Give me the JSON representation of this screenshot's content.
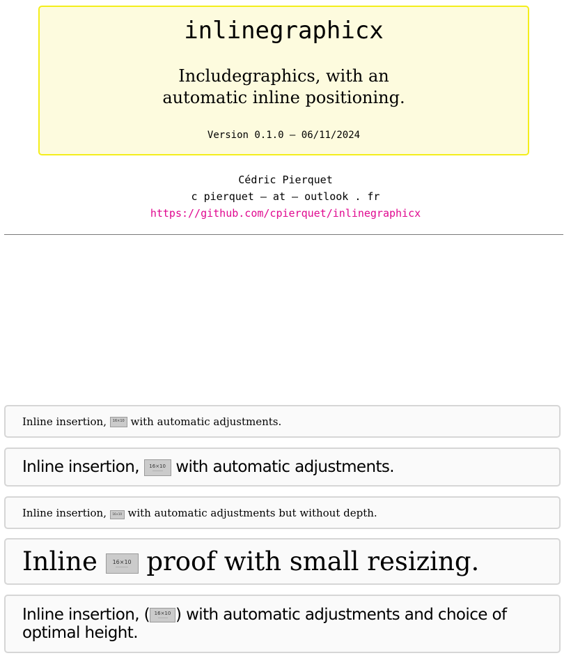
{
  "header": {
    "package_name": "inlinegraphicx",
    "subtitle_line1": "Includegraphics, with an",
    "subtitle_line2": "automatic inline positioning.",
    "version": "Version 0.1.0 – 06/11/2024"
  },
  "author": {
    "name": "Cédric Pierquet",
    "email": "c pierquet – at – outlook . fr",
    "url": "https://github.com/cpierquet/inlinegraphicx"
  },
  "colors": {
    "title_box_background": "#fdfbde",
    "title_box_border": "#f4ee1c",
    "link": "#e0088f",
    "demo_background": "#fafafa",
    "demo_border": "#d6d6d6"
  },
  "placeholder_image": {
    "label": "16×10"
  },
  "demos": [
    {
      "before": "Inline insertion, ",
      "after": " with automatic adjustments."
    },
    {
      "before": "Inline insertion, ",
      "after": " with automatic adjustments."
    },
    {
      "before": "Inline insertion, ",
      "after": " with automatic adjustments but without depth."
    },
    {
      "before": "Inline ",
      "after": " proof with small resizing."
    },
    {
      "before": "Inline insertion, (",
      "after": ") with automatic adjustments and choice of optimal height."
    }
  ]
}
